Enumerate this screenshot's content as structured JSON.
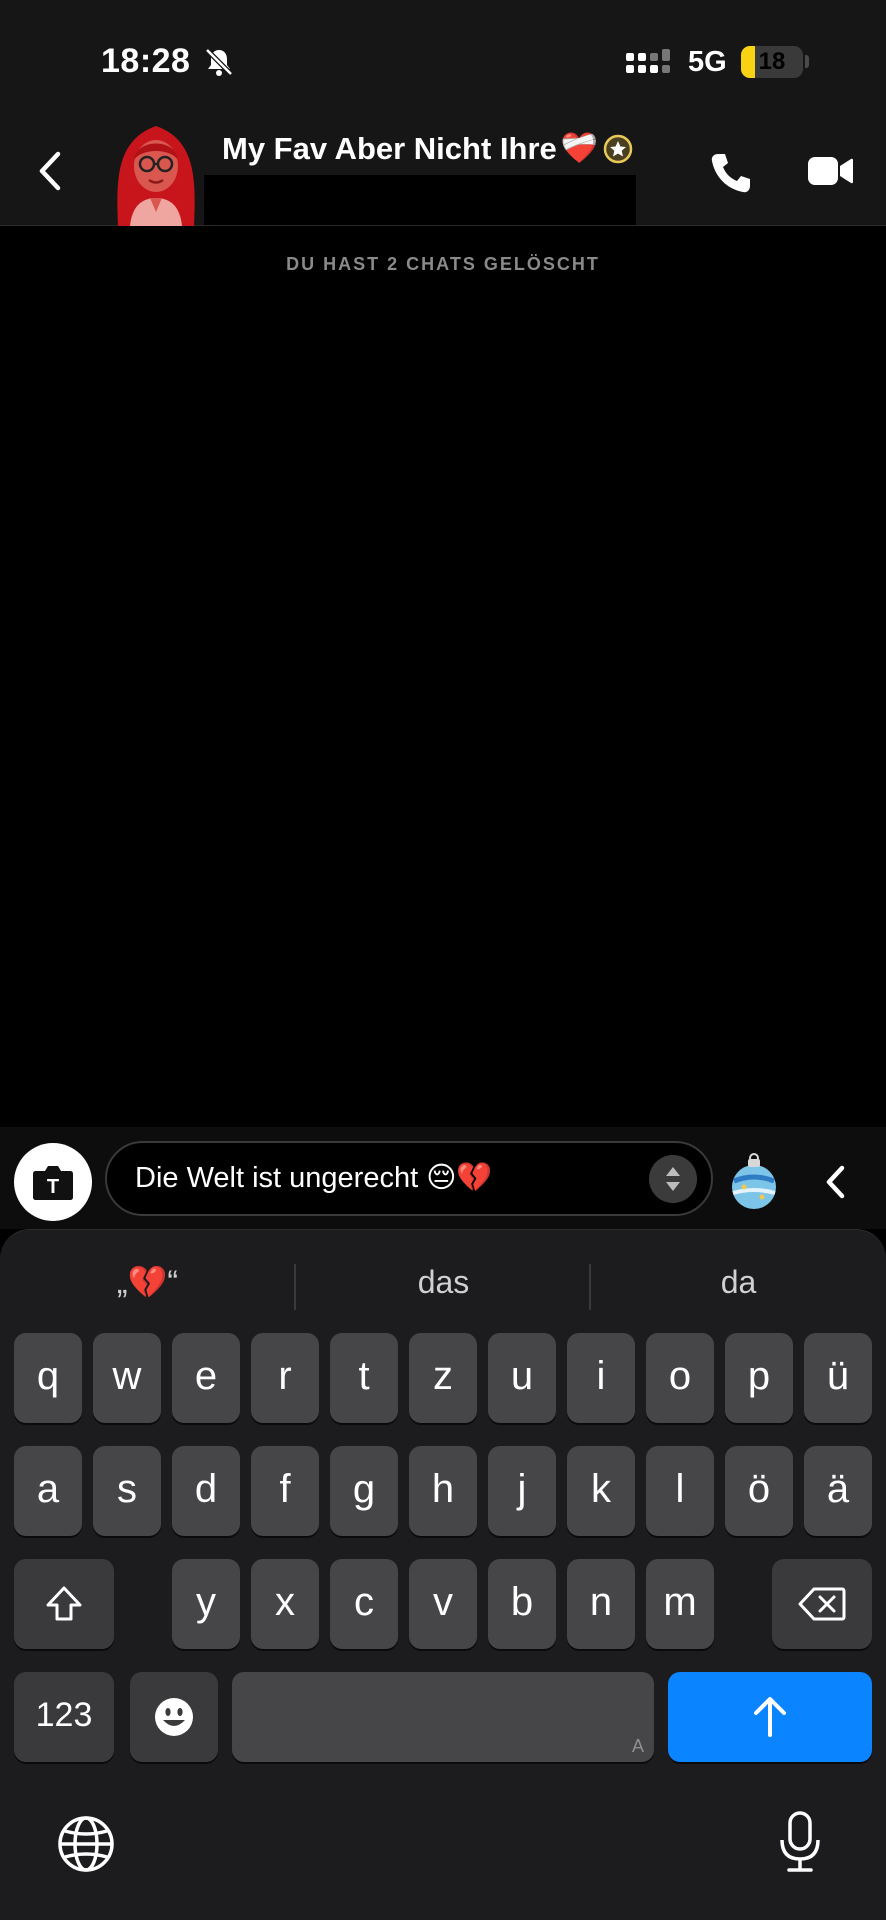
{
  "status_bar": {
    "time": "18:28",
    "network": "5G",
    "battery_level": "18",
    "battery_fraction": 0.18
  },
  "chat_header": {
    "title": "My Fav Aber Nicht Ihre",
    "title_emoji": "❤️‍🩹",
    "back_icon": "chevron-left-icon",
    "call_icon": "phone-icon",
    "video_icon": "video-camera-icon"
  },
  "chat": {
    "system_note": "DU HAST 2 CHATS GELÖSCHT"
  },
  "composer": {
    "camera_label": "T",
    "input_value": "Die Welt ist ungerecht 😔💔"
  },
  "keyboard": {
    "suggestions": [
      "„💔“",
      "das",
      "da"
    ],
    "rows": [
      [
        "q",
        "w",
        "e",
        "r",
        "t",
        "z",
        "u",
        "i",
        "o",
        "p",
        "ü"
      ],
      [
        "a",
        "s",
        "d",
        "f",
        "g",
        "h",
        "j",
        "k",
        "l",
        "ö",
        "ä"
      ],
      [
        "y",
        "x",
        "c",
        "v",
        "b",
        "n",
        "m"
      ]
    ],
    "numbers_key": "123",
    "space_hint": "A"
  },
  "colors": {
    "send_key": "#0a84ff",
    "battery": "#f7d313"
  }
}
